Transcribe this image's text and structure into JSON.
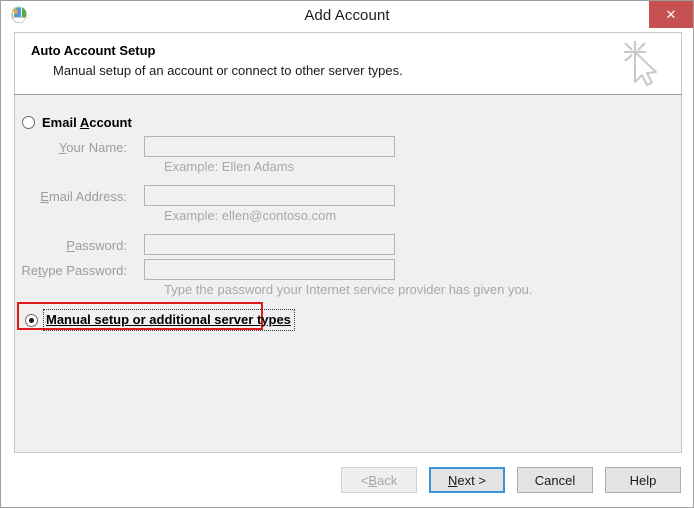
{
  "window": {
    "title": "Add Account",
    "app_icon": "outlook-globe-icon",
    "close_label": "✕",
    "close_color": "#c75050"
  },
  "header": {
    "title": "Auto Account Setup",
    "subtitle": "Manual setup of an account or connect to other server types.",
    "wizard_icon": "magic-wand-cursor-icon"
  },
  "form": {
    "email_account": {
      "label_before": "Email ",
      "accel": "A",
      "label_after": "ccount",
      "selected": false
    },
    "fields": [
      {
        "label_before": "",
        "accel": "Y",
        "label_after": "our Name:",
        "value": "",
        "placeholder": "",
        "hint": "Example: Ellen Adams",
        "disabled": true
      },
      {
        "label_before": "",
        "accel": "E",
        "label_after": "mail Address:",
        "value": "",
        "placeholder": "",
        "hint": "Example: ellen@contoso.com",
        "disabled": true
      },
      {
        "label_before": "",
        "accel": "P",
        "label_after": "assword:",
        "value": "",
        "placeholder": "",
        "hint": "",
        "disabled": true
      },
      {
        "label_before": "Re",
        "accel": "t",
        "label_after": "ype Password:",
        "value": "",
        "placeholder": "",
        "hint": "Type the password your Internet service provider has given you.",
        "disabled": true
      }
    ],
    "manual_setup": {
      "label": "Manual setup or additional server types",
      "selected": true,
      "focused": true,
      "annotation_color": "#e01b1b"
    }
  },
  "footer": {
    "buttons": [
      {
        "label_before": "< ",
        "accel": "B",
        "label_after": "ack",
        "state": "disabled"
      },
      {
        "label_before": "",
        "accel": "N",
        "label_after": "ext >",
        "state": "default"
      },
      {
        "label_before": "Cancel",
        "accel": "",
        "label_after": "",
        "state": "normal"
      },
      {
        "label_before": "Help",
        "accel": "",
        "label_after": "",
        "state": "normal"
      }
    ]
  }
}
